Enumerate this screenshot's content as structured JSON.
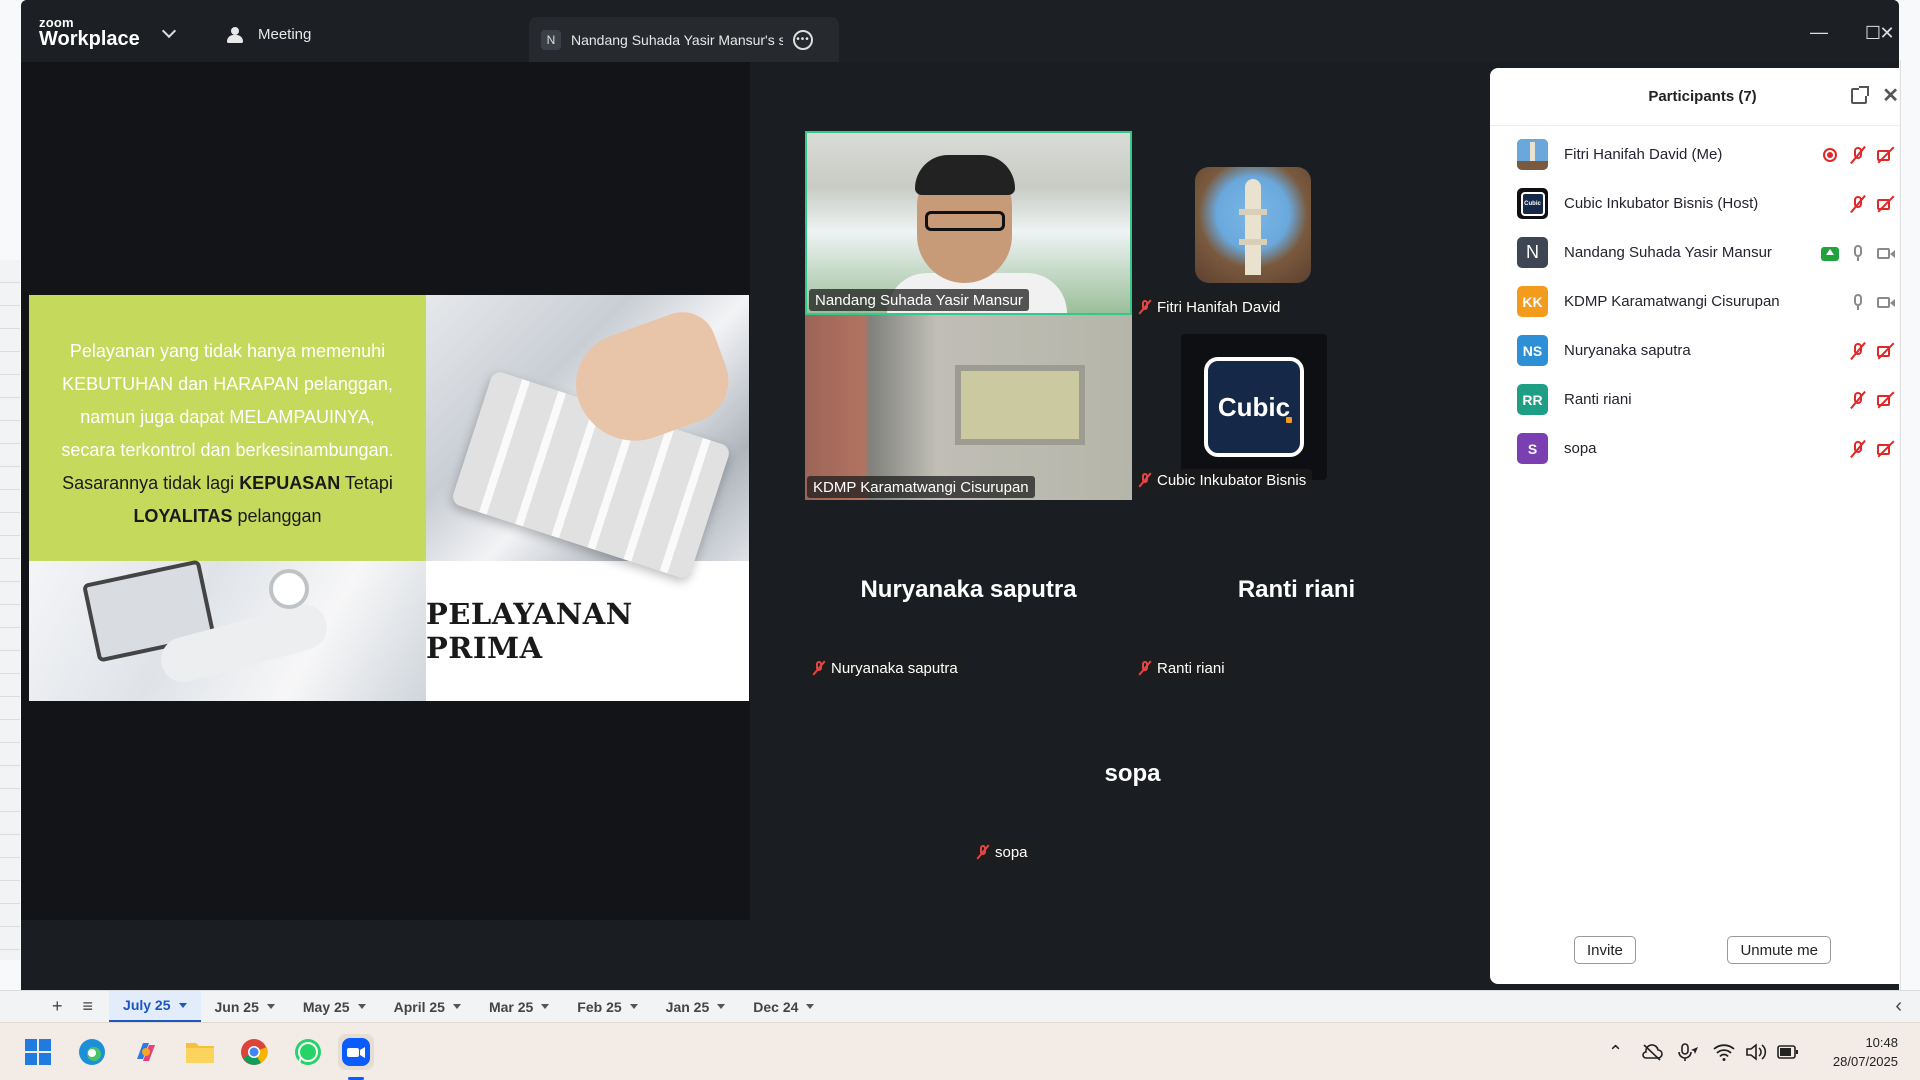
{
  "titlebar": {
    "logo_small": "zoom",
    "logo_big": "Workplace",
    "meeting_tab": "Meeting",
    "share_tab_badge": "N",
    "share_tab_label": "Nandang Suhada Yasir Mansur's sc",
    "minimize": "—",
    "maximize": "☐",
    "close": "✕"
  },
  "slide": {
    "line1": "Pelayanan yang tidak hanya memenuhi",
    "line2": "KEBUTUHAN dan HARAPAN pelanggan,",
    "line3": "namun juga dapat MELAMPAUINYA,",
    "line4": "secara terkontrol dan berkesinambungan.",
    "line5_pre": "Sasarannya tidak lagi ",
    "line5_bold": "KEPUASAN",
    "line5_post": " Tetapi",
    "line6_bold": "LOYALITAS",
    "line6_post": " pelanggan",
    "title": "PELAYANAN PRIMA"
  },
  "gallery": {
    "nandang_tag": "Nandang Suhada Yasir Mansur",
    "fitri_tag": "Fitri Hanifah David",
    "kdmp_tag": "KDMP Karamatwangi Cisurupan",
    "cubic_tag": "Cubic Inkubator Bisnis",
    "cubic_logo": "Cubic",
    "nuryanaka_big": "Nuryanaka saputra",
    "nuryanaka_tag": "Nuryanaka saputra",
    "ranti_big": "Ranti riani",
    "ranti_tag": "Ranti riani",
    "sopa_big": "sopa",
    "sopa_tag": "sopa"
  },
  "participants": {
    "title": "Participants (7)",
    "list": [
      {
        "initials": "",
        "name": "Fitri Hanifah David (Me)",
        "color": "#5b7fa3"
      },
      {
        "initials": "Cubic",
        "name": "Cubic Inkubator Bisnis (Host)",
        "color": "#0d0f12"
      },
      {
        "initials": "N",
        "name": "Nandang Suhada Yasir Mansur",
        "color": "#3d4652"
      },
      {
        "initials": "KK",
        "name": "KDMP Karamatwangi Cisurupan",
        "color": "#f29b1d"
      },
      {
        "initials": "NS",
        "name": "Nuryanaka saputra",
        "color": "#2d8fd5"
      },
      {
        "initials": "RR",
        "name": "Ranti riani",
        "color": "#1f9e86"
      },
      {
        "initials": "S",
        "name": "sopa",
        "color": "#7a3fb0"
      }
    ],
    "invite": "Invite",
    "unmute": "Unmute me"
  },
  "sheet_tabs": {
    "add": "+",
    "menu": "≡",
    "tabs": [
      "July 25",
      "Jun 25",
      "May 25",
      "April 25",
      "Mar 25",
      "Feb 25",
      "Jan 25",
      "Dec 24"
    ],
    "scroll_left": "‹"
  },
  "taskbar": {
    "time": "10:48",
    "date": "28/07/2025",
    "tray_up": "⌃"
  },
  "colors": {
    "slide_green": "#c5d95c",
    "active_speaker": "#35c88b",
    "muted_red": "#e02828",
    "zoom_blue": "#0b5cff"
  }
}
